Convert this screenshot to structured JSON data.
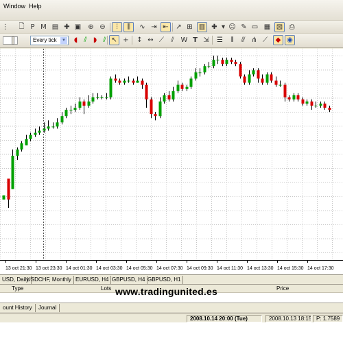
{
  "menu": {
    "items": [
      "Window",
      "Help"
    ]
  },
  "toolbar": {
    "period_combo": "Every tick",
    "icons_row1": [
      "new-chart-icon",
      "profiles-icon",
      "market-watch-icon",
      "data-window-icon",
      "navigator-icon",
      "terminal-icon",
      "strategy-tester-icon",
      "zoom-in-icon",
      "zoom-out-icon",
      "bar-chart-icon",
      "candlestick-icon",
      "line-chart-icon",
      "auto-scroll-icon",
      "chart-shift-icon",
      "indicators-icon",
      "periods-icon",
      "templates-icon",
      "new-order-icon",
      "expert-advisors-icon",
      "history-center-icon",
      "options-icon",
      "screenshot-icon"
    ],
    "icons_row2": [
      "tester-play-icon",
      "tester-stop-icon",
      "cursor-icon",
      "crosshair-icon",
      "vertical-line-icon",
      "horizontal-line-icon",
      "trendline-icon",
      "equidistant-channel-icon",
      "fibonacci-icon",
      "text-icon",
      "text-label-icon",
      "arrows-icon",
      "gann-icon",
      "channel-icon",
      "pitchfork-icon",
      "fibo-fan-icon",
      "color-icon"
    ]
  },
  "chart_data": {
    "type": "candlestick",
    "x_tick_labels": [
      "13 oct 21:30",
      "13 oct 23:30",
      "14 oct 01:30",
      "14 oct 03:30",
      "14 oct 05:30",
      "14 oct 07:30",
      "14 oct 09:30",
      "14 oct 11:30",
      "14 oct 13:30",
      "14 oct 15:30",
      "14 oct 17:30"
    ],
    "grid": true,
    "bull_color": "#00a000",
    "bear_color": "#d80000",
    "candles": [
      [
        0.29,
        0.31,
        0.37,
        0.37
      ],
      [
        0.39,
        0.29,
        0.39,
        0.25
      ],
      [
        0.34,
        0.5,
        0.53,
        0.34
      ],
      [
        0.5,
        0.53,
        0.54,
        0.48
      ],
      [
        0.53,
        0.56,
        0.57,
        0.52
      ],
      [
        0.55,
        0.58,
        0.6,
        0.55
      ],
      [
        0.58,
        0.6,
        0.61,
        0.57
      ],
      [
        0.6,
        0.61,
        0.63,
        0.59
      ],
      [
        0.61,
        0.62,
        0.64,
        0.6
      ],
      [
        0.62,
        0.63,
        0.66,
        0.61
      ],
      [
        0.63,
        0.64,
        0.67,
        0.62
      ],
      [
        0.64,
        0.64,
        0.66,
        0.63
      ],
      [
        0.64,
        0.66,
        0.68,
        0.63
      ],
      [
        0.66,
        0.69,
        0.71,
        0.65
      ],
      [
        0.69,
        0.72,
        0.73,
        0.68
      ],
      [
        0.72,
        0.72,
        0.74,
        0.7
      ],
      [
        0.72,
        0.73,
        0.75,
        0.71
      ],
      [
        0.73,
        0.76,
        0.78,
        0.72
      ],
      [
        0.76,
        0.74,
        0.77,
        0.7
      ],
      [
        0.74,
        0.76,
        0.79,
        0.73
      ],
      [
        0.76,
        0.78,
        0.8,
        0.75
      ],
      [
        0.78,
        0.78,
        0.8,
        0.77
      ],
      [
        0.78,
        0.78,
        0.79,
        0.77
      ],
      [
        0.78,
        0.78,
        0.8,
        0.77
      ],
      [
        0.78,
        0.87,
        0.88,
        0.77
      ],
      [
        0.87,
        0.86,
        0.89,
        0.85
      ],
      [
        0.86,
        0.85,
        0.87,
        0.84
      ],
      [
        0.85,
        0.86,
        0.87,
        0.84
      ],
      [
        0.86,
        0.86,
        0.88,
        0.85
      ],
      [
        0.86,
        0.85,
        0.87,
        0.84
      ],
      [
        0.85,
        0.86,
        0.88,
        0.85
      ],
      [
        0.86,
        0.84,
        0.87,
        0.82
      ],
      [
        0.84,
        0.77,
        0.85,
        0.73
      ],
      [
        0.77,
        0.7,
        0.78,
        0.68
      ],
      [
        0.7,
        0.69,
        0.71,
        0.67
      ],
      [
        0.69,
        0.76,
        0.78,
        0.68
      ],
      [
        0.76,
        0.79,
        0.8,
        0.75
      ],
      [
        0.79,
        0.77,
        0.81,
        0.76
      ],
      [
        0.77,
        0.81,
        0.83,
        0.76
      ],
      [
        0.81,
        0.84,
        0.86,
        0.8
      ],
      [
        0.84,
        0.82,
        0.85,
        0.81
      ],
      [
        0.82,
        0.83,
        0.84,
        0.81
      ],
      [
        0.83,
        0.87,
        0.88,
        0.82
      ],
      [
        0.87,
        0.9,
        0.92,
        0.86
      ],
      [
        0.9,
        0.9,
        0.92,
        0.88
      ],
      [
        0.9,
        0.93,
        0.94,
        0.89
      ],
      [
        0.93,
        0.93,
        0.95,
        0.92
      ],
      [
        0.93,
        0.96,
        0.98,
        0.92
      ],
      [
        0.96,
        0.96,
        0.98,
        0.94
      ],
      [
        0.96,
        0.94,
        0.97,
        0.93
      ],
      [
        0.94,
        0.96,
        0.97,
        0.93
      ],
      [
        0.96,
        0.95,
        0.97,
        0.94
      ],
      [
        0.95,
        0.94,
        0.96,
        0.93
      ],
      [
        0.94,
        0.88,
        0.95,
        0.87
      ],
      [
        0.88,
        0.85,
        0.89,
        0.84
      ],
      [
        0.85,
        0.89,
        0.91,
        0.84
      ],
      [
        0.89,
        0.91,
        0.92,
        0.88
      ],
      [
        0.91,
        0.87,
        0.92,
        0.85
      ],
      [
        0.87,
        0.85,
        0.89,
        0.84
      ],
      [
        0.85,
        0.89,
        0.9,
        0.84
      ],
      [
        0.89,
        0.86,
        0.9,
        0.85
      ],
      [
        0.86,
        0.84,
        0.88,
        0.83
      ],
      [
        0.84,
        0.84,
        0.86,
        0.83
      ],
      [
        0.84,
        0.78,
        0.85,
        0.76
      ],
      [
        0.78,
        0.77,
        0.79,
        0.76
      ],
      [
        0.77,
        0.79,
        0.8,
        0.76
      ],
      [
        0.79,
        0.77,
        0.8,
        0.76
      ],
      [
        0.77,
        0.75,
        0.78,
        0.74
      ],
      [
        0.75,
        0.76,
        0.77,
        0.74
      ],
      [
        0.76,
        0.74,
        0.77,
        0.72
      ],
      [
        0.74,
        0.74,
        0.76,
        0.73
      ],
      [
        0.74,
        0.75,
        0.76,
        0.73
      ],
      [
        0.75,
        0.73,
        0.76,
        0.72
      ],
      [
        0.73,
        0.72,
        0.74,
        0.71
      ]
    ]
  },
  "chart_tabs": [
    "USD, Daily",
    "USDCHF, Monthly",
    "EURUSD, H4",
    "GBPUSD, H4",
    "GBPUSD, H1"
  ],
  "terminal": {
    "columns": [
      "Type",
      "Lots",
      "Price"
    ],
    "watermark": "www.tradingunited.es",
    "tabs": [
      "ount History",
      "Journal"
    ]
  },
  "status": {
    "datetime": "2008.10.14 20:00 (Tue)",
    "bar_time": "2008.10.13 18:15",
    "price": "P: 1.7589"
  },
  "colors": {
    "chrome": "#ece9d8",
    "grid": "#c8c8c8",
    "cursor_line": "#555555"
  }
}
